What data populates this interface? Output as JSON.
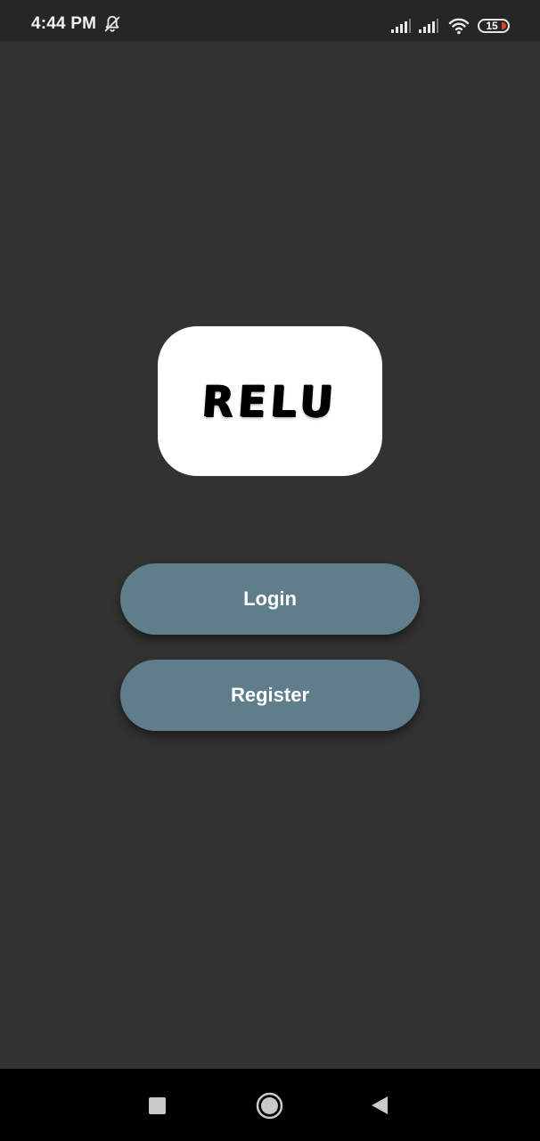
{
  "status_bar": {
    "time": "4:44 PM",
    "battery_level": "15",
    "icons": [
      "bell-off-icon",
      "signal-icon",
      "signal-icon",
      "wifi-icon",
      "battery-icon"
    ],
    "battery_low_color": "#e53935"
  },
  "logo": {
    "text": "RELU"
  },
  "actions": {
    "login_label": "Login",
    "register_label": "Register"
  },
  "nav_bar": {
    "icons": [
      "recents-square-icon",
      "home-circle-icon",
      "back-triangle-icon"
    ]
  },
  "colors": {
    "background": "#323232",
    "button": "#607d8b",
    "logo_card": "#ffffff"
  }
}
